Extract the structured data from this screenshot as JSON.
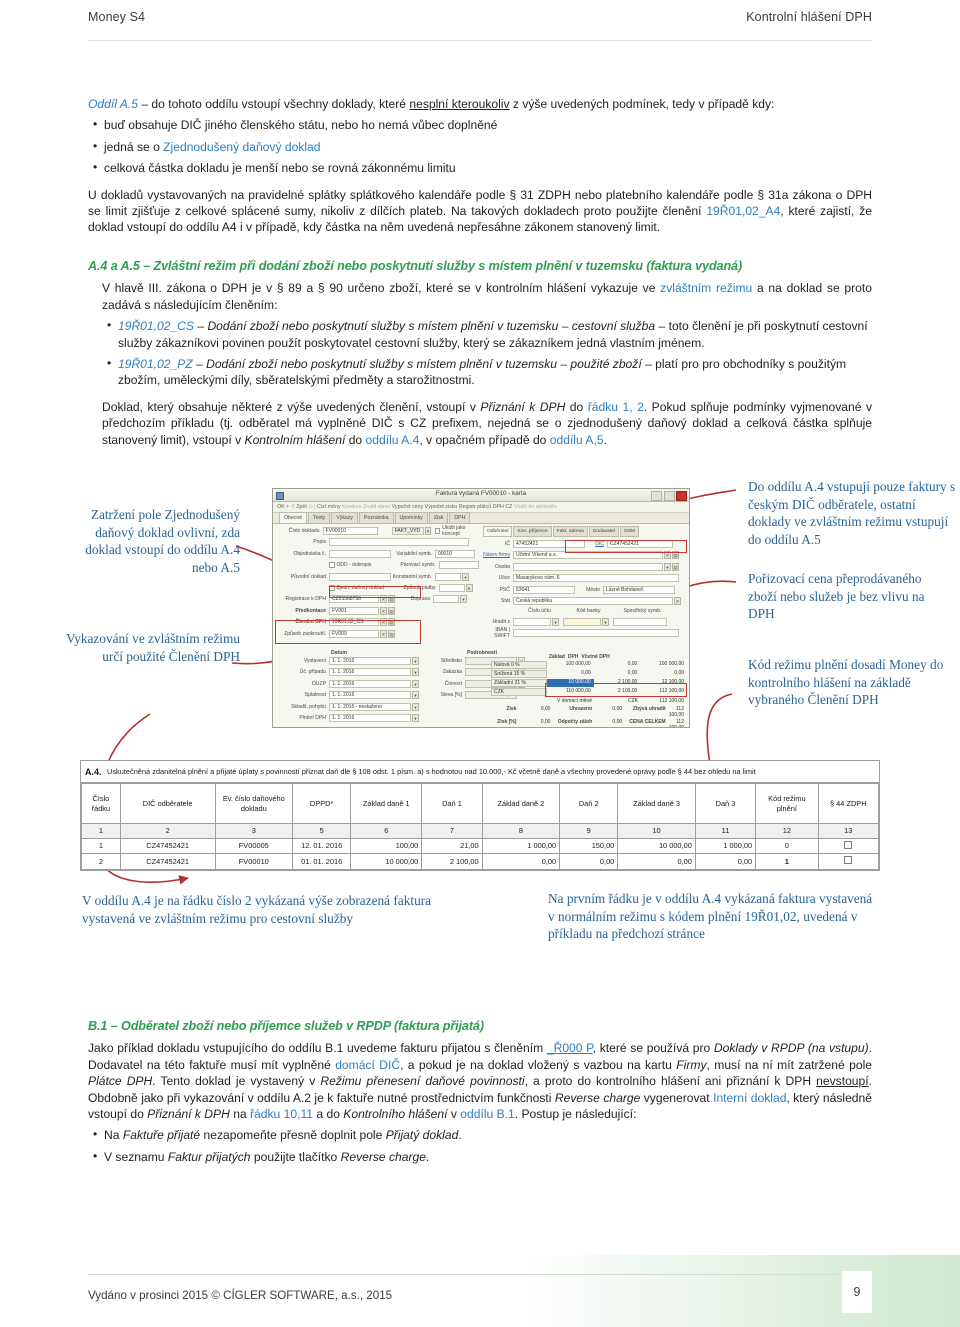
{
  "runhead": {
    "left": "Money S4",
    "right": "Kontrolní hlášení DPH"
  },
  "section_a5": {
    "lead_label": "Oddíl A.5",
    "lead_rest_1": " – do tohoto oddílu vstoupí všechny doklady, které ",
    "lead_underline": "nesplní kteroukoliv",
    "lead_rest_2": " z výše uvedených podmínek, tedy v případě kdy:",
    "bullets": [
      {
        "pre": "buď obsahuje DIČ jiného členského státu, nebo ho nemá vůbec doplněné",
        "link": "",
        "post": ""
      },
      {
        "pre": "jedná se o ",
        "link": "Zjednodušený daňový doklad",
        "post": ""
      },
      {
        "pre": "celková částka dokladu je menší nebo se rovná zákonnému limitu",
        "link": "",
        "post": ""
      }
    ],
    "para": {
      "p1": "U dokladů vystavovaných na pravidelné splátky splátkového kalendáře podle § 31 ZDPH nebo platebního kalendáře podle § 31a zákona o DPH se limit zjišťuje z celkové splácené sumy, nikoliv z dílčích plateb. Na takových dokladech proto použijte členění ",
      "code": "19Ř01,02_A4",
      "p2": ", které zajistí, že doklad vstoupí do oddílu A4 i v případě, kdy částka na něm uvedená nepřesáhne zákonem stanovený limit."
    }
  },
  "section_a4a5": {
    "heading": "A.4 a A.5 – Zvláštní režim při dodání zboží nebo poskytnutí služby s místem plnění v tuzemsku (faktura vydaná)",
    "intro_1": "V hlavě III. zákona o DPH je v § 89 a § 90 určeno zboží, které se v kontrolním hlášení vykazuje ve ",
    "intro_link": "zvláštním režimu",
    "intro_2": " a na doklad se proto zadává s následujícím členěním:",
    "items": [
      {
        "code": "19Ř01,02_CS",
        "dash": " – ",
        "italic": "Dodání zboží nebo poskytnutí služby s místem plnění v tuzemsku – cestovní služba",
        "rest": " – toto členění je při poskytnutí cestovní služby zákazníkovi povinen použít poskytovatel cestovní služby, který se zákazníkem jedná vlastním jménem."
      },
      {
        "code": "19Ř01,02_PZ",
        "dash": " – ",
        "italic": "Dodání zboží nebo poskytnutí služby s místem plnění v tuzemsku – použité zboží",
        "rest": " – platí pro pro obchodníky s použitým zbožím, uměleckými díly, sběratelskými předměty a starožitnostmi."
      }
    ],
    "closing": {
      "t1": "Doklad, který obsahuje některé z výše uvedených členění, vstoupí v ",
      "i1": "Přiznání k DPH",
      "t2": " do ",
      "l1": "řádku 1, 2",
      "t3": ". Pokud splňuje podmínky vyjmenované v předchozím příkladu (tj. odběratel má vyplněné DIČ s CZ prefixem, nejedná se o zjednodušený daňový doklad a celková částka splňuje stanovený limit), vstoupí v ",
      "i2": "Kontrolním hlášení",
      "t4": " do ",
      "l2": "oddílu A.4",
      "t5": ", v opačném případě do ",
      "l3": "oddílu A,5",
      "t6": "."
    }
  },
  "annotations": {
    "left_top": "Zatržení pole Zjednodušený daňový doklad ovlivní, zda doklad vstoupí do oddílu A.4 nebo A.5",
    "left_bottom": "Vykazování ve zvláštním režimu určí použité Členění DPH",
    "right_top": "Do oddílu A.4 vstupují pouze faktury s českým DIČ odběratele, ostatní doklady ve zvláštním režimu vstupují do oddílu A.5",
    "right_mid": "Pořizovací cena přeprodávaného zboží nebo služeb je bez vlivu na DPH",
    "right_bottom": "Kód režimu plnění dosadí Money do kontrolního hlášení na základě vybraného Členění DPH",
    "below_left": "V oddílu A.4 je na řádku číslo 2 vykázaná výše zobrazená faktura vystavená ve zvláštním režimu pro cestovní služby",
    "below_right": "Na prvním řádku je v oddílu A.4 vykázaná faktura vystavená v normálním režimu s kódem plnění 19Ř01,02, uvedená v příkladu na předchozí stránce"
  },
  "app_window": {
    "title": "Faktura vydaná FV00010 - karta",
    "toolbar": [
      "OK",
      "Zpět",
      "Cizí měny",
      "Korekce",
      "Zrušit slevu",
      "Vypočet ceny",
      "Výpočet zisku",
      "Registr plátců DPH CZ",
      "Vložit do adresáře"
    ],
    "tabs": [
      "Obecné",
      "Texty",
      "Výkazy",
      "Poznámka",
      "Upomínky",
      "Zisk",
      "DPH"
    ],
    "left_fields": [
      {
        "label": "Číslo dokladu",
        "value": "FV00010",
        "value2": "FAKT_VYD"
      },
      {
        "label": "Popis",
        "value": ""
      },
      {
        "label": "Objednávka č.",
        "value": ""
      },
      {
        "label": "Původní doklad",
        "value": ""
      },
      {
        "label": "Registrace k DPH",
        "value": "CZ25568756"
      },
      {
        "label": "Předkontace",
        "value": "FV001"
      },
      {
        "label": "Členění DPH",
        "value": "19Ř01,02_CS"
      },
      {
        "label": "Způsob zaokrouhl.",
        "value": "FV009"
      }
    ],
    "left_checks": [
      {
        "label": "Uložit jako koncept"
      },
      {
        "label": "ODD - dobropis"
      },
      {
        "label": "Zjedn. daňový doklad"
      }
    ],
    "mid_fields": [
      {
        "label": "Variabilní symb.",
        "value": "00010"
      },
      {
        "label": "Párovací symb.",
        "value": ""
      },
      {
        "label": "Konstantní symb.",
        "value": ""
      },
      {
        "label": "Způsob platby",
        "value": ""
      },
      {
        "label": "Doprava",
        "value": ""
      }
    ],
    "right_tabs": [
      "Odběratel",
      "Kon. příjemce",
      "Fakt. adresa",
      "Dodavatel",
      "OSM"
    ],
    "right_fields": [
      {
        "label": "IČ",
        "value": "47452421",
        "label2": "DIČ",
        "value2": "CZ47452421"
      },
      {
        "label": "Název firmy",
        "value": "Účetní Víkend a.s."
      },
      {
        "label": "Osoba",
        "value": ""
      },
      {
        "label": "Ulice",
        "value": "Masarykovo nám. 6"
      },
      {
        "label": "PSČ",
        "value": "53041",
        "label2": "Město",
        "value2": "Lázně Bohdaneč"
      },
      {
        "label": "Stát",
        "value": "Česká republika"
      }
    ],
    "bank_headers": [
      "Číslo účtu",
      "Kód banky",
      "Specifický symb."
    ],
    "bank_rows": [
      "Hradit z",
      "IBAN | SWIFT"
    ],
    "date_header": "Datum",
    "dates": [
      {
        "label": "Vystavení",
        "value": "1. 1. 2016"
      },
      {
        "label": "Úč. případu",
        "value": "1. 1. 2016"
      },
      {
        "label": "DUZP",
        "value": "1. 1. 2016"
      },
      {
        "label": "Splatnost",
        "value": "1. 1. 2016"
      },
      {
        "label": "Skladš. pohybu",
        "value": "1. 1. 2016 - nestaženo"
      },
      {
        "label": "Plnění DPH",
        "value": "1. 1. 2016"
      }
    ],
    "podrobnosti_header": "Podrobnosti",
    "podrobnosti": [
      {
        "label": "Středisko",
        "value": ""
      },
      {
        "label": "Zakázka",
        "value": ""
      },
      {
        "label": "Činnost",
        "value": ""
      },
      {
        "label": "Sleva [%]",
        "value": "0,00"
      }
    ],
    "vat_header": [
      "Základ",
      "DPH",
      "Včetně DPH"
    ],
    "vat_rows": [
      {
        "name": "Nulová 0 %",
        "base": "100 000,00",
        "tax": "0,00",
        "total": "100 000,00"
      },
      {
        "name": "Snížená 15 %",
        "base": "0,00",
        "tax": "0,00",
        "total": "0,00"
      },
      {
        "name": "Základní 21 %",
        "base": "10 000,00",
        "tax": "2 100,00",
        "total": "12 100,00"
      },
      {
        "name": "CZK",
        "base": "110 000,00",
        "tax": "2 100,00",
        "total": "112 100,00"
      }
    ],
    "currency_row": {
      "label": "V domácí měně",
      "value": "CZK",
      "total": "112 100,00"
    },
    "totals": [
      {
        "label": "Zisk",
        "value": "0,00",
        "label2": "Uhrazeno",
        "value2": "0,00",
        "label3": "Zbývá uhradit",
        "value3": "112 100,00"
      },
      {
        "label": "Zisk [%]",
        "value": "0,00",
        "label2": "Odpočty záloh",
        "value2": "0,00",
        "label3": "CENA CELKEM",
        "value3": "112 100,00"
      }
    ]
  },
  "a4_table": {
    "tag": "A.4.",
    "caption": "Uskutečněná zdanitelná plnění a přijaté úplaty s povinností přiznat daň dle § 108 odst. 1 písm. a) s hodnotou nad 10.000,- Kč včetně daně a všechny provedené opravy podle § 44 bez ohledu na limit",
    "headers": [
      "Číslo řádku",
      "DIČ odběratele",
      "Ev. číslo daňového dokladu",
      "DPPD*",
      "Základ daně 1",
      "Daň 1",
      "Základ daně 2",
      "Daň 2",
      "Základ daně 3",
      "Daň 3",
      "Kód režimu plnění",
      "§ 44 ZDPH"
    ],
    "colnums": [
      "1",
      "2",
      "3",
      "5",
      "6",
      "7",
      "8",
      "9",
      "10",
      "11",
      "12",
      "13"
    ],
    "rows": [
      {
        "cells": [
          "1",
          "CZ47452421",
          "FV00005",
          "12. 01. 2016",
          "100,00",
          "21,00",
          "1 000,00",
          "150,00",
          "10 000,00",
          "1 000,00",
          "0"
        ],
        "checkbox": true,
        "bold_code": false
      },
      {
        "cells": [
          "2",
          "CZ47452421",
          "FV00010",
          "01. 01. 2016",
          "10 000,00",
          "2 100,00",
          "0,00",
          "0,00",
          "0,00",
          "0,00",
          "1"
        ],
        "checkbox": true,
        "bold_code": true
      }
    ]
  },
  "section_b1": {
    "heading": "B.1 – Odběratel zboží nebo příjemce služeb v RPDP (faktura přijatá)",
    "p": {
      "t1": "Jako příklad dokladu vstupujícího do oddílu B.1 uvedeme fakturu přijatou s členěním ",
      "l1": "_Ř000 P",
      "t2": ", které se používá pro ",
      "i1": "Doklady v RPDP (na vstupu)",
      "t3": ". Dodavatel na této faktuře musí mít vyplněné ",
      "l2": "domácí DIČ",
      "t4": ", a pokud je na doklad vložený s vazbou na kartu ",
      "i2": "Firmy",
      "t5": ", musí na ní mít zatržené pole ",
      "i3": "Plátce DPH",
      "t6": ". Tento doklad je vystavený v ",
      "i4": "Režimu přenesení daňové povinnosti",
      "t7": ", a proto do kontrolního hlášení ani přiznání k DPH ",
      "u1": "nevstoupí",
      "t8": ". Obdobně jako při vykazování v oddílu A.2 je k faktuře nutné prostřednictvím funkčnosti ",
      "i5": "Reverse charge",
      "t9": " vygenerovat ",
      "l3": "Interní doklad",
      "t10": ", který následně vstoupí do ",
      "i6": "Přiznání k DPH",
      "t11": " na ",
      "l4": "řádku 10,11",
      "t12": " a do ",
      "i7": "Kontrolního hlášení",
      "t13": " v ",
      "l5": "oddílu B.1",
      "t14": ". Postup je následující:"
    },
    "bullets": [
      {
        "t1": "Na ",
        "i1": "Faktuře přijaté",
        "t2": " nezapomeňte přesně doplnit pole ",
        "i2": "Přijatý doklad",
        "t3": "."
      },
      {
        "t1": "V seznamu ",
        "i1": "Faktur přijatých",
        "t2": " použijte tlačítko ",
        "i2": "Reverse charge",
        "t3": "."
      }
    ]
  },
  "footer": {
    "text": "Vydáno v prosinci 2015 © CÍGLER SOFTWARE, a.s., 2015",
    "page": "9"
  },
  "colors": {
    "link": "#2e7fc1",
    "heading_green": "#2f9e52",
    "annotation": "#2a6496",
    "arrow_red": "#b5302a"
  }
}
